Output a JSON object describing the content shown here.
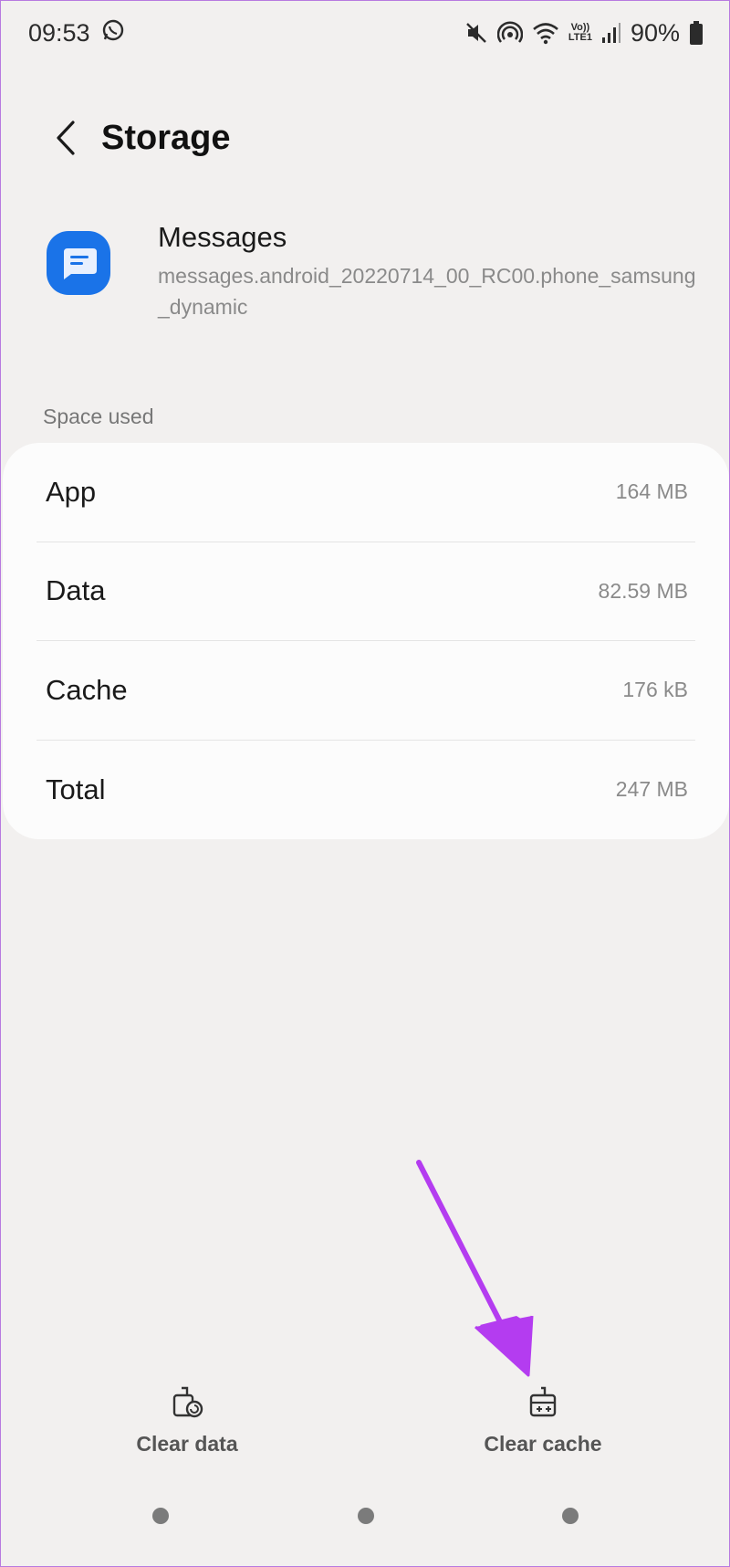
{
  "status_bar": {
    "time": "09:53",
    "network": "LTE1",
    "volte": "Vo))",
    "battery": "90%"
  },
  "header": {
    "title": "Storage"
  },
  "app": {
    "name": "Messages",
    "version": "messages.android_20220714_00_RC00.phone_samsung_dynamic"
  },
  "space_used": {
    "label": "Space used",
    "rows": [
      {
        "label": "App",
        "value": "164 MB"
      },
      {
        "label": "Data",
        "value": "82.59 MB"
      },
      {
        "label": "Cache",
        "value": "176 kB"
      },
      {
        "label": "Total",
        "value": "247 MB"
      }
    ]
  },
  "actions": {
    "clear_data": "Clear data",
    "clear_cache": "Clear cache"
  },
  "colors": {
    "app_icon": "#1a73e8",
    "annotation_arrow": "#b43cf0"
  }
}
